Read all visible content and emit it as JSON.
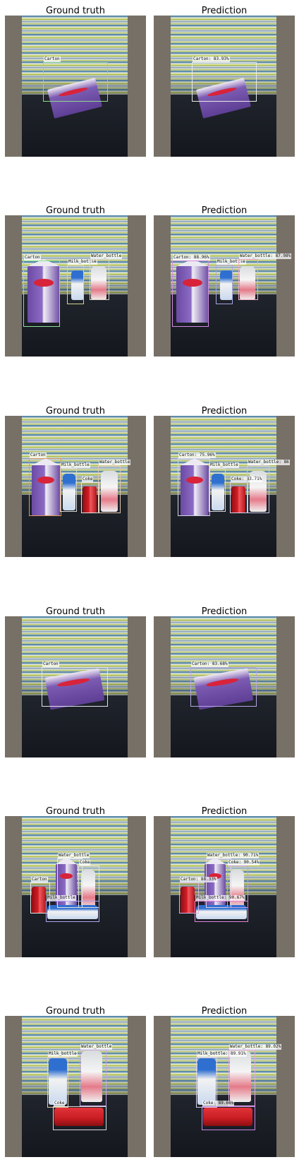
{
  "grid": {
    "left_title": "Ground truth",
    "right_title": "Prediction"
  },
  "rows": [
    {
      "gt": [
        {
          "label": "Carton",
          "color": "#8fd88a"
        }
      ],
      "pred": [
        {
          "label": "Carton: 83.93%",
          "color": "#e9e9e9"
        }
      ]
    },
    {
      "gt": [
        {
          "label": "Carton",
          "color": "#8ee39a"
        },
        {
          "label": "Milk_bottle",
          "color": "#d7d68e"
        },
        {
          "label": "Water_bottle",
          "color": "#d9d7c8"
        }
      ],
      "pred": [
        {
          "label": "Carton: 88.96%",
          "color": "#d48be8"
        },
        {
          "label": "Milk_bottle",
          "color": "#a9a6e6"
        },
        {
          "label": "Water_bottle: 87.98%",
          "color": "#f3a9c8"
        }
      ]
    },
    {
      "gt": [
        {
          "label": "Carton",
          "color": "#e39a5a"
        },
        {
          "label": "Milk_bottle",
          "color": "#d7d6d0"
        },
        {
          "label": "Coke",
          "color": "#e8e2dc"
        },
        {
          "label": "Water_bottle",
          "color": "#e2c8ae"
        }
      ],
      "pred": [
        {
          "label": "Carton: 75.96%",
          "color": "#d5d5ea"
        },
        {
          "label": "Milk_bottle",
          "color": "#d6d6d6"
        },
        {
          "label": "Coke: 83.71%",
          "color": "#d8d2ea"
        },
        {
          "label": "Water_bottle: 86",
          "color": "#c8c5e0"
        }
      ]
    },
    {
      "gt": [
        {
          "label": "Carton",
          "color": "#e2e2e8"
        }
      ],
      "pred": [
        {
          "label": "Carton: 83.68%",
          "color": "#b7a6e3"
        }
      ]
    },
    {
      "gt": [
        {
          "label": "Carton",
          "color": "#e6e6e6"
        },
        {
          "label": "Water_bottle",
          "color": "#e3e3e3"
        },
        {
          "label": "Coke",
          "color": "#e0e0e0"
        },
        {
          "label": "Milk_bottle",
          "color": "#b0a6ef"
        }
      ],
      "pred": [
        {
          "label": "Carton: 88.33%",
          "color": "#d8b5de"
        },
        {
          "label": "Water_bottle: 90.71%",
          "color": "#ddd0e6"
        },
        {
          "label": "Coke: 90.54%",
          "color": "#c59ee3"
        },
        {
          "label": "Milk_bottle: 90.67%",
          "color": "#e285d9"
        }
      ]
    },
    {
      "gt": [
        {
          "label": "Milk_bottle",
          "color": "#e6d1a8"
        },
        {
          "label": "Water_bottle",
          "color": "#c7a3e8"
        },
        {
          "label": "Coke",
          "color": "#dcdcdc"
        }
      ],
      "pred": [
        {
          "label": "Milk_bottle: 89.91%",
          "color": "#d9d0ea"
        },
        {
          "label": "Water_bottle: 89.02%",
          "color": "#e6a7e6"
        },
        {
          "label": "Coke: 89.66%",
          "color": "#c58ae8"
        }
      ]
    }
  ]
}
